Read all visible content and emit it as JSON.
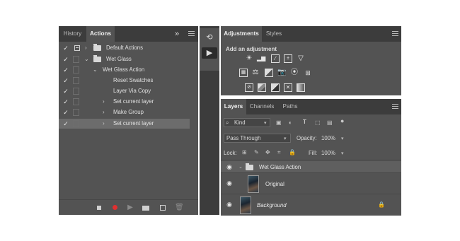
{
  "colors": {
    "panel_bg": "#535353",
    "tab_bar": "#3c3c3c",
    "record_red": "#e03030",
    "selected_row": "#6c6c6c"
  },
  "actions_panel": {
    "tabs": [
      {
        "label": "History",
        "active": false
      },
      {
        "label": "Actions",
        "active": true
      }
    ],
    "collapse_glyph": "»",
    "rows": [
      {
        "checked": "✓",
        "label": "Default Actions",
        "type": "set",
        "expanded": false
      },
      {
        "checked": "✓",
        "label": "Wet Glass",
        "type": "set",
        "expanded": true
      },
      {
        "checked": "✓",
        "label": "Wet Glass Action",
        "type": "action",
        "expanded": true
      },
      {
        "checked": "✓",
        "label": "Reset Swatches",
        "type": "step"
      },
      {
        "checked": "✓",
        "label": "Layer Via Copy",
        "type": "step"
      },
      {
        "checked": "✓",
        "label": "Set current layer",
        "type": "step-collapsible"
      },
      {
        "checked": "✓",
        "label": "Make Group",
        "type": "step-collapsible"
      },
      {
        "checked": "✓",
        "label": "Set current layer",
        "type": "step-collapsible",
        "selected": true
      }
    ],
    "bottom_icons": [
      "stop-icon",
      "record-icon",
      "play-icon",
      "new-set-icon",
      "new-action-icon",
      "trash-icon"
    ]
  },
  "adjustments_panel": {
    "tabs": [
      {
        "label": "Adjustments",
        "active": true
      },
      {
        "label": "Styles",
        "active": false
      }
    ],
    "title": "Add an adjustment",
    "icons": [
      [
        "brightness-contrast-icon",
        "levels-icon",
        "curves-icon",
        "exposure-icon",
        "vibrance-icon"
      ],
      [
        "hue-saturation-icon",
        "color-balance-icon",
        "black-white-icon",
        "photo-filter-icon",
        "channel-mixer-icon",
        "color-lookup-icon"
      ],
      [
        "invert-icon",
        "posterize-icon",
        "threshold-icon",
        "selective-color-icon",
        "gradient-map-icon"
      ]
    ]
  },
  "layers_panel": {
    "tabs": [
      {
        "label": "Layers",
        "active": true
      },
      {
        "label": "Channels",
        "active": false
      },
      {
        "label": "Paths",
        "active": false
      }
    ],
    "filter_value": "Kind",
    "blend_mode": "Pass Through",
    "opacity_label": "Opacity:",
    "opacity_value": "100%",
    "lock_label": "Lock:",
    "fill_label": "Fill:",
    "fill_value": "100%",
    "layers": [
      {
        "name": "Wet Glass Action",
        "type": "group",
        "selected": true
      },
      {
        "name": "Original",
        "type": "layer"
      },
      {
        "name": "Background",
        "type": "background",
        "locked": true
      }
    ]
  }
}
